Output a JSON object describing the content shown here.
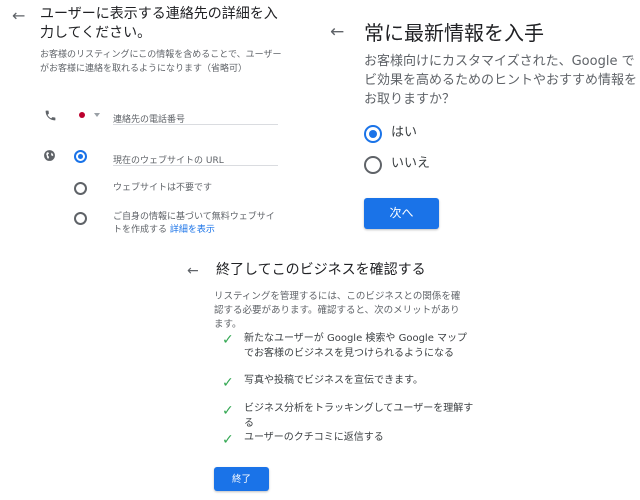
{
  "panel_contact": {
    "title": "ユーザーに表示する連絡先の詳細を入力してください。",
    "description": "お客様のリスティングにこの情報を含めることで、ユーザーがお客様に連絡を取れるようになります（省略可）",
    "phone_placeholder": "連絡先の電話番号",
    "website_options": [
      {
        "label": "現在のウェブサイトの URL",
        "selected": true
      },
      {
        "label": "ウェブサイトは不要です",
        "selected": false
      },
      {
        "label": "ご自身の情報に基づいて無料ウェブサイトを作成する",
        "selected": false
      }
    ],
    "details_link": "詳細を表示"
  },
  "panel_updates": {
    "title": "常に最新情報を入手",
    "description": "お客様向けにカスタマイズされた、Google でビ効果を高めるためのヒントやおすすめ情報をお取りますか？",
    "options": [
      {
        "label": "はい",
        "selected": true
      },
      {
        "label": "いいえ",
        "selected": false
      }
    ],
    "next_button": "次へ"
  },
  "panel_verify": {
    "title": "終了してこのビジネスを確認する",
    "description": "リスティングを管理するには、このビジネスとの関係を確認する必要があります。確認すると、次のメリットがあります。",
    "benefits": [
      "新たなユーザーが Google 検索や Google マップでお客様のビジネスを見つけられるようになる",
      "写真や投稿でビジネスを宣伝できます。",
      "ビジネス分析をトラッキングしてユーザーを理解する",
      "ユーザーのクチコミに返信する"
    ],
    "finish_button": "終了"
  },
  "icons": {
    "back": "arrow-back-icon",
    "phone": "phone-icon",
    "globe": "globe-icon",
    "check": "check-icon",
    "flag": "japan-flag-icon",
    "dropdown": "dropdown-arrow-icon"
  },
  "colors": {
    "accent": "#1a73e8",
    "check": "#34a853",
    "text": "#202124",
    "muted": "#5f6368"
  }
}
